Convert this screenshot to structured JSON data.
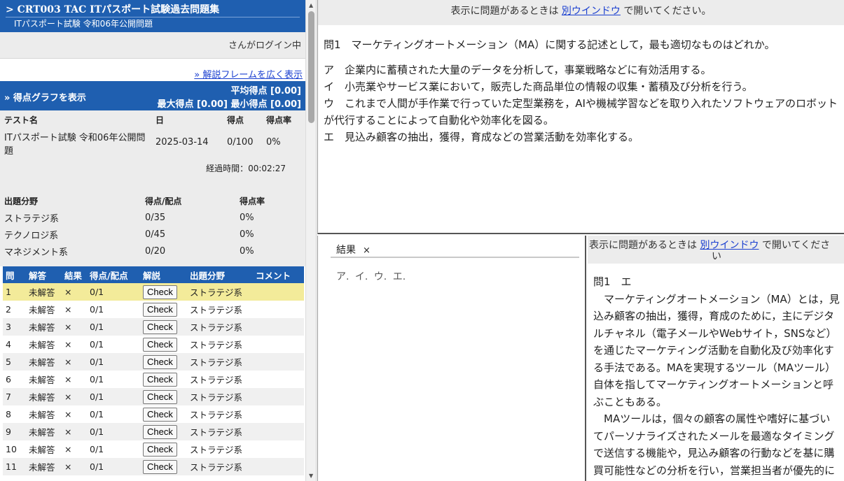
{
  "left": {
    "title": "> CRT003 TAC ITパスポート試験過去問題集",
    "subtitle": "ITパスポート試験 令和06年公開問題",
    "login_text": "さんがログイン中",
    "expand_link": "» 解説フレームを広く表示",
    "score": {
      "show_graph": "» 得点グラフを表示",
      "avg": "平均得点 [0.00]",
      "max": "最大得点 [0.00]",
      "min": "最小得点 [0.00]"
    },
    "summary": {
      "headers": [
        "テスト名",
        "日",
        "得点",
        "得点率"
      ],
      "row": [
        "ITパスポート試験 令和06年公開問題",
        "2025-03-14",
        "0/100",
        "0%"
      ],
      "elapsed": "経過時間：00:02:27"
    },
    "categories": {
      "headers": [
        "出題分野",
        "得点/配点",
        "得点率"
      ],
      "rows": [
        [
          "ストラテジ系",
          "0/35",
          "0%"
        ],
        [
          "テクノロジ系",
          "0/45",
          "0%"
        ],
        [
          "マネジメント系",
          "0/20",
          "0%"
        ]
      ]
    },
    "questions": {
      "headers": [
        "問",
        "解答",
        "結果",
        "得点/配点",
        "解説",
        "出題分野",
        "コメント"
      ],
      "check_label": "Check",
      "rows": [
        [
          "1",
          "未解答",
          "×",
          "0/1",
          "ストラテジ系"
        ],
        [
          "2",
          "未解答",
          "×",
          "0/1",
          "ストラテジ系"
        ],
        [
          "3",
          "未解答",
          "×",
          "0/1",
          "ストラテジ系"
        ],
        [
          "4",
          "未解答",
          "×",
          "0/1",
          "ストラテジ系"
        ],
        [
          "5",
          "未解答",
          "×",
          "0/1",
          "ストラテジ系"
        ],
        [
          "6",
          "未解答",
          "×",
          "0/1",
          "ストラテジ系"
        ],
        [
          "7",
          "未解答",
          "×",
          "0/1",
          "ストラテジ系"
        ],
        [
          "8",
          "未解答",
          "×",
          "0/1",
          "ストラテジ系"
        ],
        [
          "9",
          "未解答",
          "×",
          "0/1",
          "ストラテジ系"
        ],
        [
          "10",
          "未解答",
          "×",
          "0/1",
          "ストラテジ系"
        ],
        [
          "11",
          "未解答",
          "×",
          "0/1",
          "ストラテジ系"
        ]
      ]
    }
  },
  "top_frame": {
    "notice_prefix": "表示に問題があるときは ",
    "notice_link": "別ウインドウ",
    "notice_suffix": " で開いてください。",
    "question": "問1　マーケティングオートメーション（MA）に関する記述として，最も適切なものはどれか。",
    "options": [
      "ア　企業内に蓄積された大量のデータを分析して，事業戦略などに有効活用する。",
      "イ　小売業やサービス業において，販売した商品単位の情報の収集・蓄積及び分析を行う。",
      "ウ　これまで人間が手作業で行っていた定型業務を，AIや機械学習などを取り入れたソフトウェアのロボットが代行することによって自動化や効率化を図る。",
      "エ　見込み顧客の抽出，獲得，育成などの営業活動を効率化する。"
    ]
  },
  "result_frame": {
    "tab_label": "結果",
    "close": "×",
    "choices": "ア. イ. ウ. エ."
  },
  "explanation_frame": {
    "notice_prefix": "表示に問題があるときは ",
    "notice_link": "別ウインドウ",
    "notice_suffix": " で開いてくださ",
    "notice_wrap": "い",
    "answer": "問1　エ",
    "p1": "　マーケティングオートメーション（MA）とは，見込み顧客の抽出，獲得，育成のために，主にデジタルチャネル（電子メールやWebサイト，SNSなど）を通じたマーケティング活動を自動化及び効率化する手法である。MAを実現するツール（MAツール）自体を指してマーケティングオートメーションと呼ぶこともある。",
    "p2": "　MAツールは，個々の顧客の属性や嗜好に基づいてパーソナライズされたメールを最適なタイミングで送信する機能や，見込み顧客の行動などを基に購買可能性などの分析を行い，営業担当者が優先的にアプローチすべき顧客を絞り込む機能な"
  }
}
